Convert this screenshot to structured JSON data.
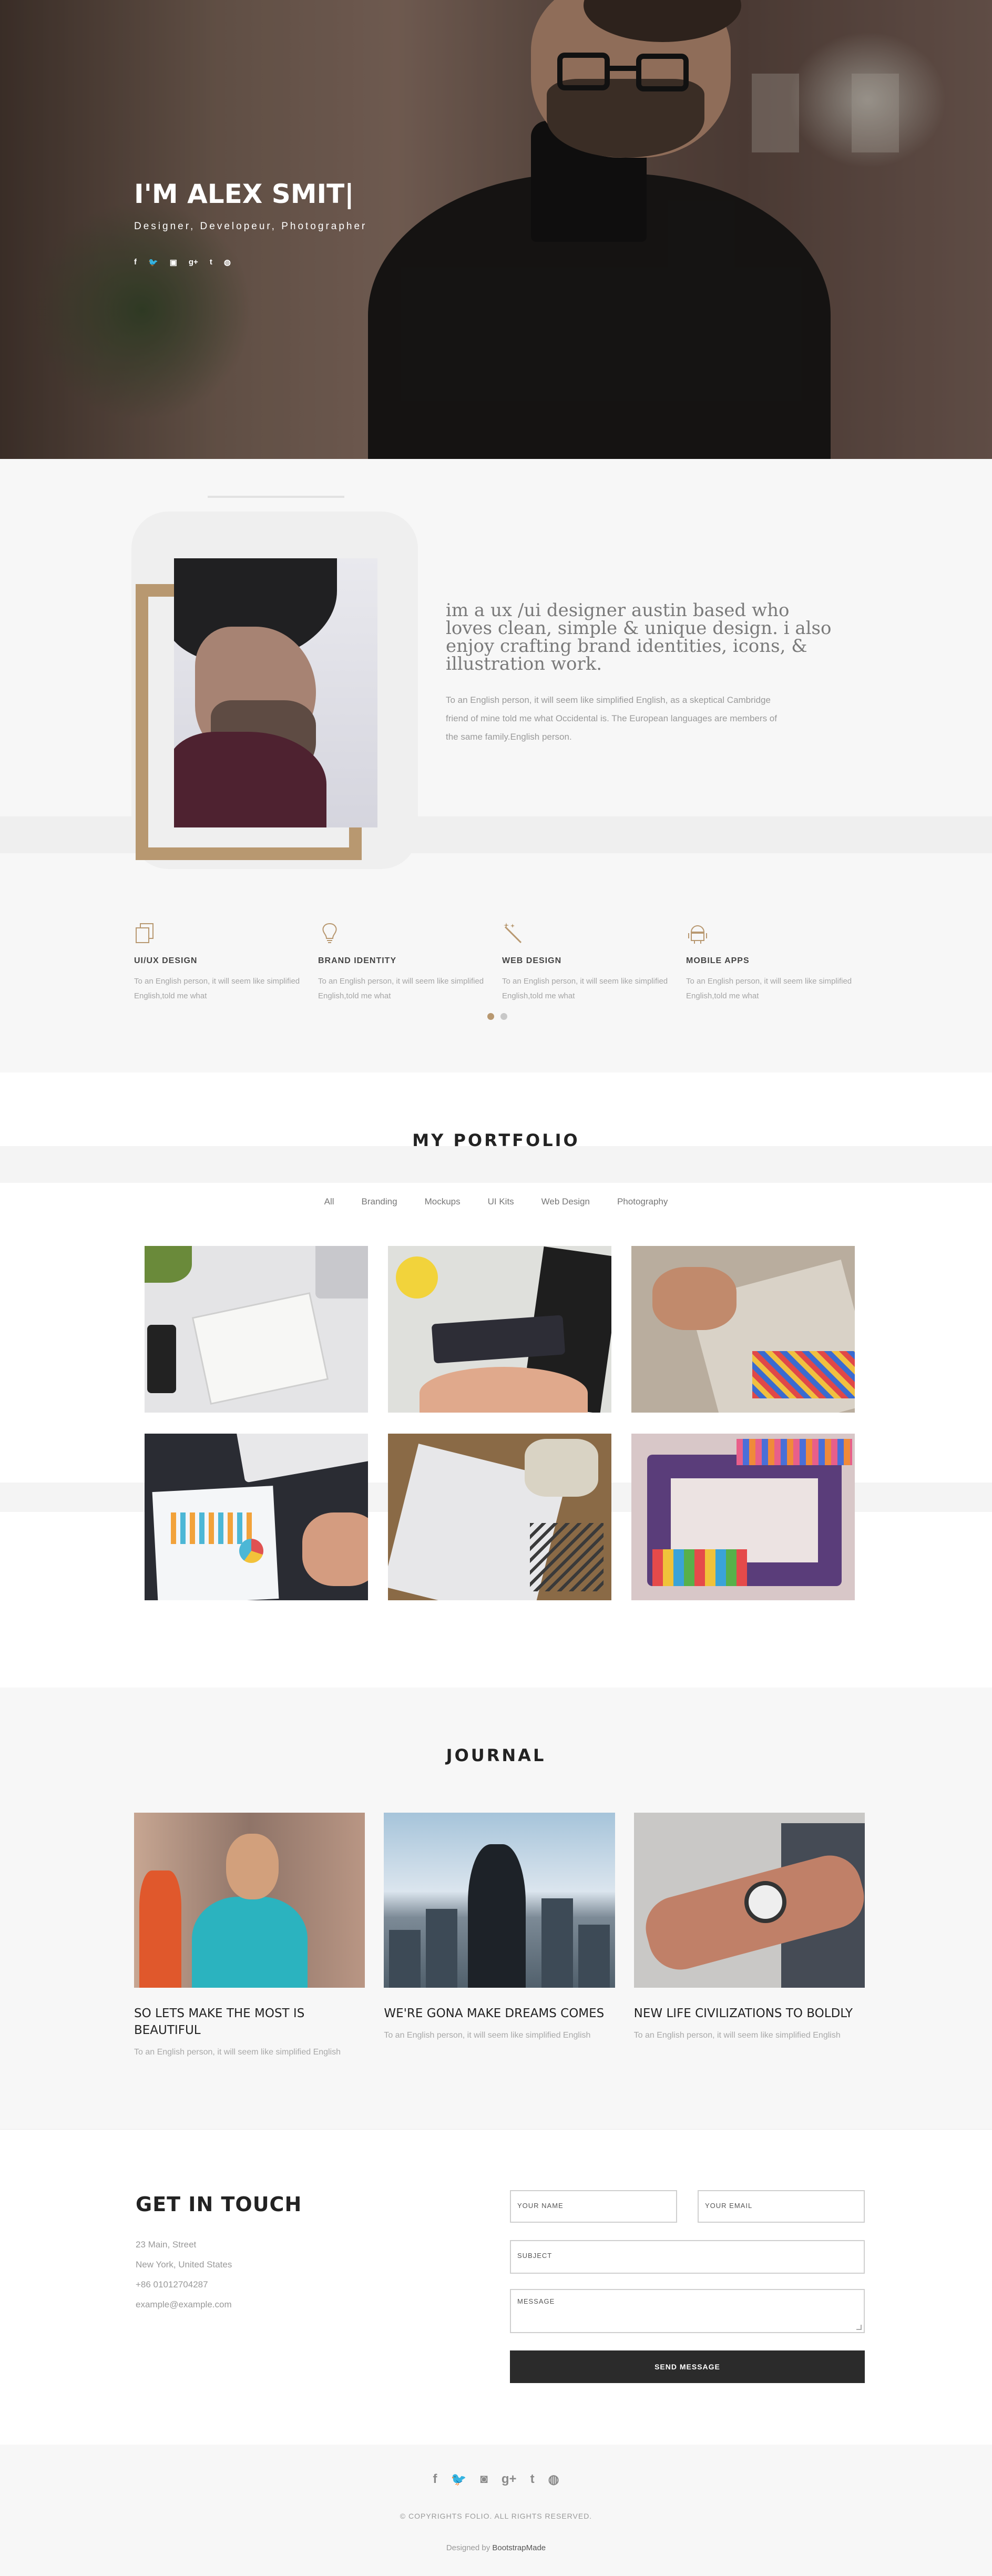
{
  "hero": {
    "title": "I'M ALEX SMIT|",
    "subtitle": "Designer, Developeur, Photographer",
    "social": [
      {
        "icon": "facebook-icon",
        "glyph": "f"
      },
      {
        "icon": "twitter-icon",
        "glyph": "🐦"
      },
      {
        "icon": "instagram-icon",
        "glyph": "▣"
      },
      {
        "icon": "google-plus-icon",
        "glyph": "g+"
      },
      {
        "icon": "tumblr-icon",
        "glyph": "t"
      },
      {
        "icon": "dribbble-icon",
        "glyph": "◍"
      }
    ]
  },
  "about": {
    "headline": "im a ux /ui designer austin based who loves clean, simple & unique design. i also enjoy crafting brand identities, icons, & illustration work.",
    "paragraph": "To an English person, it will seem like simplified English, as a skeptical Cambridge friend of mine told me what Occidental is. The European languages are members of the same family.English person.",
    "accent_color": "#b89870"
  },
  "services": [
    {
      "icon": "copy-icon",
      "title": "UI/UX DESIGN",
      "text": "To an English person, it will seem like simplified English,told me what"
    },
    {
      "icon": "lightbulb-icon",
      "title": "BRAND IDENTITY",
      "text": "To an English person, it will seem like simplified English,told me what"
    },
    {
      "icon": "magic-wand-icon",
      "title": "WEB DESIGN",
      "text": "To an English person, it will seem like simplified English,told me what"
    },
    {
      "icon": "android-icon",
      "title": "MOBILE APPS",
      "text": "To an English person, it will seem like simplified English,told me what"
    }
  ],
  "slider": {
    "active": 1,
    "count": 2
  },
  "portfolio": {
    "title": "MY PORTFOLIO",
    "filters": [
      "All",
      "Branding",
      "Mockups",
      "UI Kits",
      "Web Design",
      "Photography"
    ]
  },
  "journal": {
    "title": "JOURNAL",
    "posts": [
      {
        "title": "SO LETS MAKE THE MOST IS BEAUTIFUL",
        "text": "To an English person, it will seem like simplified English"
      },
      {
        "title": "WE'RE GONA MAKE DREAMS COMES",
        "text": "To an English person, it will seem like simplified English"
      },
      {
        "title": "NEW LIFE CIVILIZATIONS TO BOLDLY",
        "text": "To an English person, it will seem like simplified English"
      }
    ]
  },
  "contact": {
    "title": "GET IN TOUCH",
    "address1": "23 Main, Street",
    "address2": "New York, United States",
    "phone": "+86 01012704287",
    "email": "example@example.com",
    "name_placeholder": "YOUR NAME",
    "email_placeholder": "YOUR EMAIL",
    "subject_placeholder": "SUBJECT",
    "message_placeholder": "MESSAGE",
    "send_label": "SEND MESSAGE"
  },
  "footer": {
    "social": [
      {
        "icon": "facebook-icon",
        "glyph": "f"
      },
      {
        "icon": "twitter-icon",
        "glyph": "🐦"
      },
      {
        "icon": "instagram-icon",
        "glyph": "◙"
      },
      {
        "icon": "google-plus-icon",
        "glyph": "g+"
      },
      {
        "icon": "tumblr-icon",
        "glyph": "t"
      },
      {
        "icon": "dribbble-icon",
        "glyph": "◍"
      }
    ],
    "copyright": "© COPYRIGHTS FOLIO. ALL RIGHTS RESERVED.",
    "designed_by": "Designed by",
    "designer": "BootstrapMade"
  }
}
